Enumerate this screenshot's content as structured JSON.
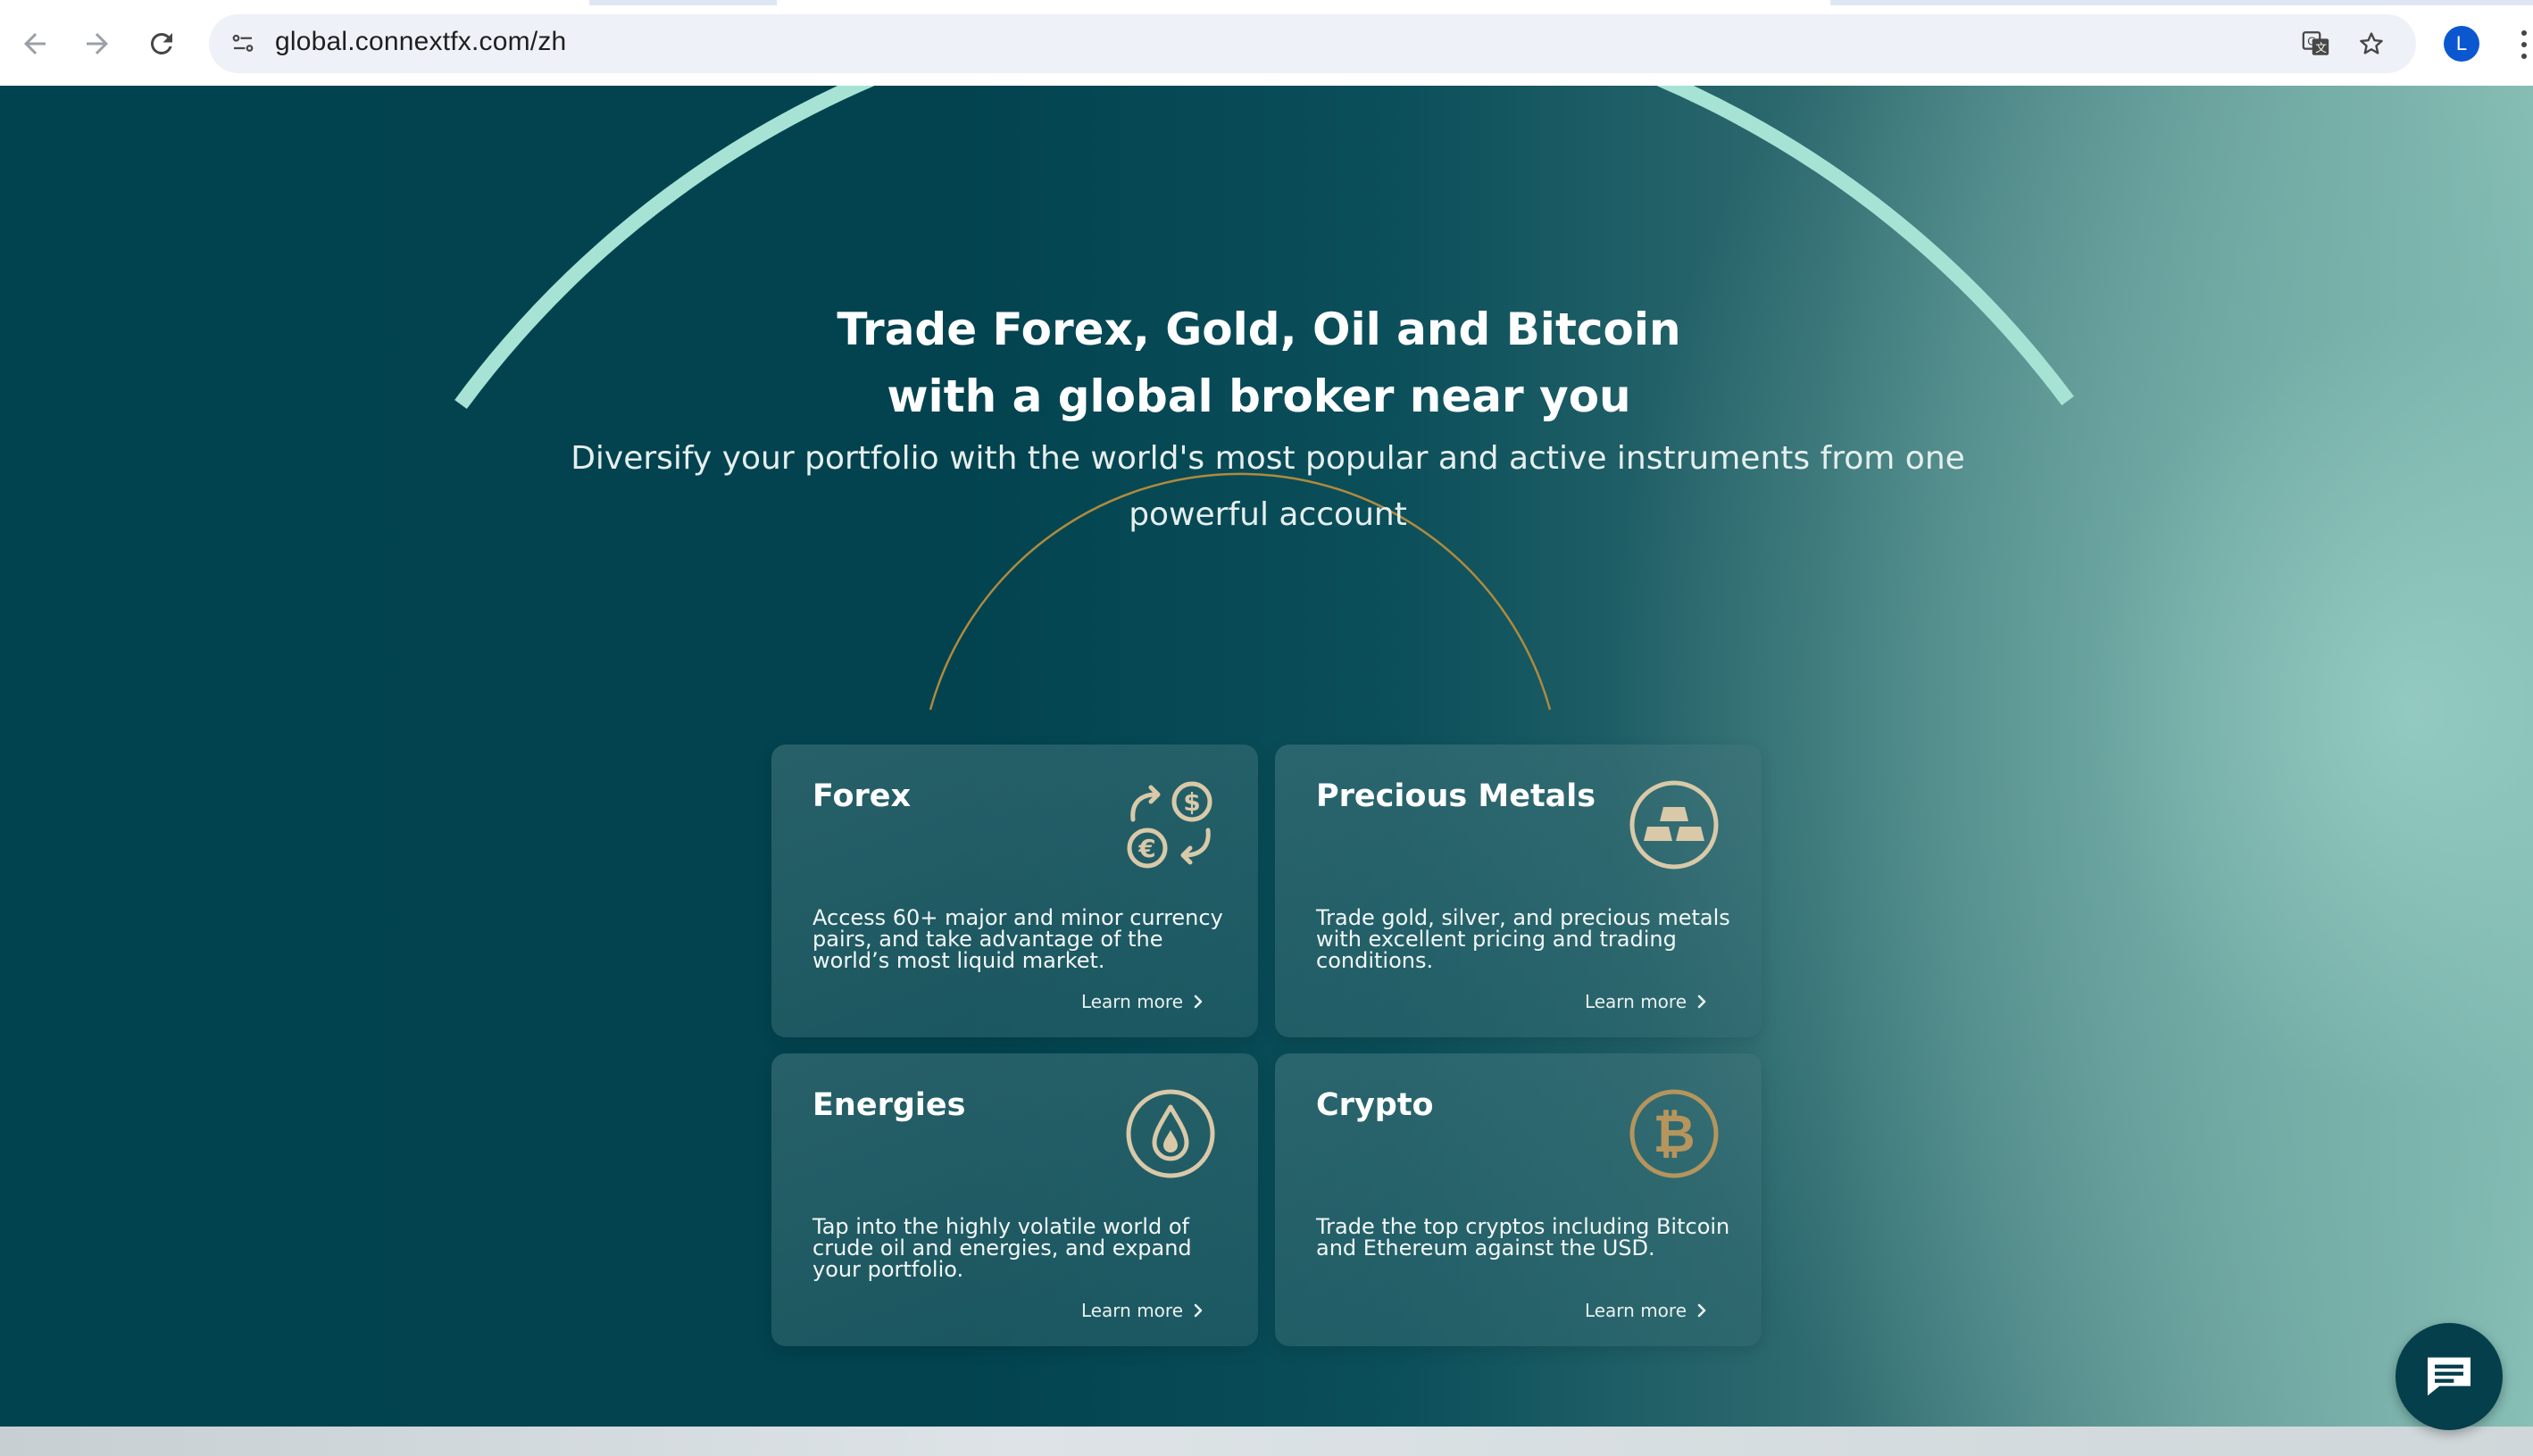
{
  "browser": {
    "url": "global.connextfx.com/zh",
    "profile_initial": "L",
    "icons": {
      "back": "arrow-left-icon",
      "forward": "arrow-right-icon",
      "reload": "reload-icon",
      "site_info": "site-settings-icon",
      "translate": "translate-icon",
      "bookmark": "star-icon",
      "menu": "kebab-menu-icon"
    }
  },
  "hero": {
    "headline_line1": "Trade Forex, Gold, Oil and Bitcoin",
    "headline_line2": "with a global broker near you",
    "subline_line1": "Diversify your portfolio with the world's most popular and active instruments from one",
    "subline_line2": "powerful account"
  },
  "cards": [
    {
      "title": "Forex",
      "icon": "currency-exchange-icon",
      "description": "Access 60+ major and minor currency pairs, and take advantage of the world’s most liquid market.",
      "link": "Learn more"
    },
    {
      "title": "Precious Metals",
      "icon": "gold-bars-icon",
      "description": "Trade gold, silver, and precious metals with excellent pricing and trading conditions.",
      "link": "Learn more"
    },
    {
      "title": "Energies",
      "icon": "oil-drop-icon",
      "description": "Tap into the highly volatile world of crude oil and energies, and expand your portfolio.",
      "link": "Learn more"
    },
    {
      "title": "Crypto",
      "icon": "bitcoin-icon",
      "description": "Trade the top cryptos including Bitcoin and Ethereum against the USD.",
      "link": "Learn more"
    }
  ],
  "chat": {
    "icon": "chat-bubble-icon"
  },
  "colors": {
    "hero_dark": "#01434f",
    "arc_mint": "#a7e3d4",
    "arc_gold": "#b08a3e",
    "icon_beige": "#d9c9a8",
    "bitcoin_gold": "#b5955c"
  }
}
